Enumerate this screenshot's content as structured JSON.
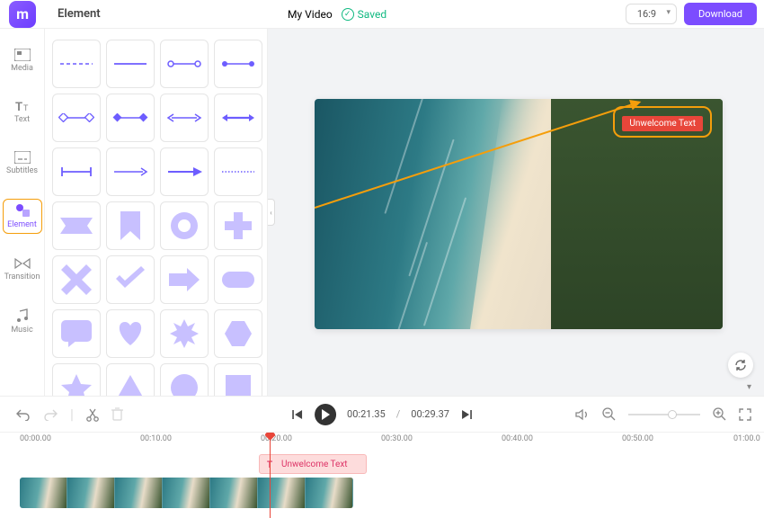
{
  "app": {
    "logo_letter": "m"
  },
  "topbar": {
    "panel_title": "Element",
    "project_name": "My Video",
    "saved_label": "Saved",
    "aspect_ratio": "16:9",
    "download_label": "Download"
  },
  "sidebar": {
    "items": [
      {
        "id": "media",
        "label": "Media"
      },
      {
        "id": "text",
        "label": "Text"
      },
      {
        "id": "subtitles",
        "label": "Subtitles"
      },
      {
        "id": "element",
        "label": "Element"
      },
      {
        "id": "transition",
        "label": "Transition"
      },
      {
        "id": "music",
        "label": "Music"
      }
    ],
    "active": "element"
  },
  "playback": {
    "current_time": "00:21.35",
    "total_time": "00:29.37",
    "separator": "/"
  },
  "timeline": {
    "ticks": [
      "00:00.00",
      "00:10.00",
      "00:20.00",
      "00:30.00",
      "00:40.00",
      "00:50.00",
      "01:00.0"
    ],
    "playhead_label": "00:20.00",
    "text_clip_label": "Unwelcome Text"
  },
  "overlay": {
    "badge_text": "Unwelcome Text"
  },
  "zoom": {
    "value_pct": 55
  },
  "colors": {
    "accent": "#7c4dff",
    "highlight_border": "#f59e0b",
    "danger": "#e8463a",
    "success": "#10b981"
  }
}
